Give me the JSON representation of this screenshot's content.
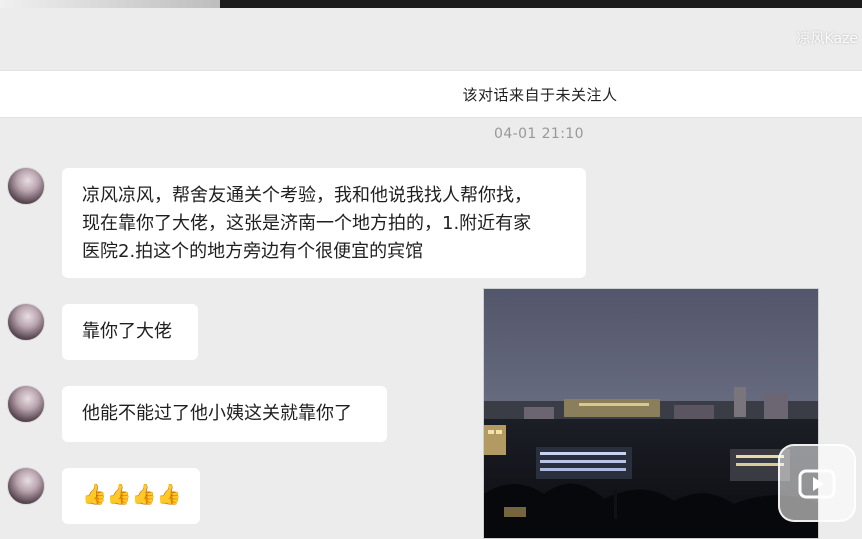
{
  "watermark": {
    "text": "凉风Kaze"
  },
  "notice": {
    "text": "该对话来自于未关注人"
  },
  "conversation": {
    "timestamp": "04-01 21:10",
    "messages": [
      {
        "lines": [
          "凉风凉风，帮舍友通关个考验，我和他说我找人帮你找，",
          "现在靠你了大佬，这张是济南一个地方拍的，1.附近有家",
          "医院2.拍这个的地方旁边有个很便宜的宾馆"
        ]
      },
      {
        "lines": [
          "靠你了大佬"
        ]
      },
      {
        "lines": [
          "他能不能过了他小姨这关就靠你了"
        ]
      },
      {
        "lines": [
          "👍👍👍👍"
        ]
      }
    ]
  },
  "colors": {
    "background": "#ececec",
    "bubble": "#ffffff",
    "timestamp": "#999999"
  },
  "icons": {
    "avatar": "user-avatar",
    "play": "play-icon"
  }
}
